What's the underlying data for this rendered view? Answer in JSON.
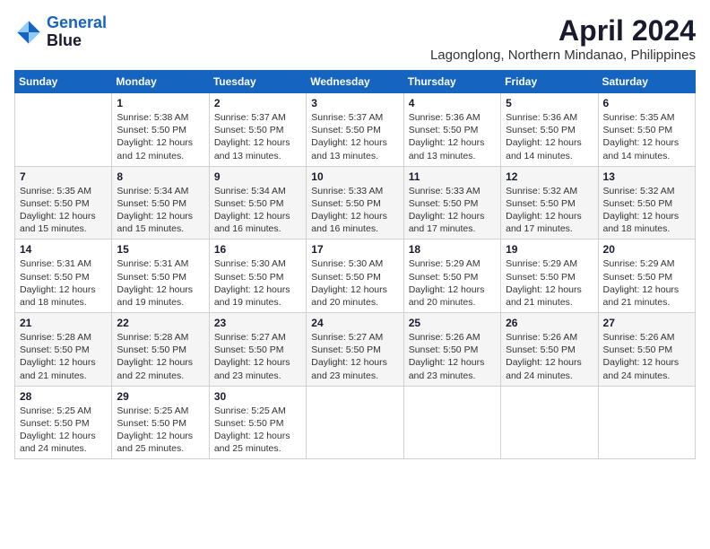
{
  "logo": {
    "line1": "General",
    "line2": "Blue"
  },
  "title": "April 2024",
  "subtitle": "Lagonglong, Northern Mindanao, Philippines",
  "days_header": [
    "Sunday",
    "Monday",
    "Tuesday",
    "Wednesday",
    "Thursday",
    "Friday",
    "Saturday"
  ],
  "weeks": [
    [
      {
        "day": "",
        "sunrise": "",
        "sunset": "",
        "daylight": ""
      },
      {
        "day": "1",
        "sunrise": "Sunrise: 5:38 AM",
        "sunset": "Sunset: 5:50 PM",
        "daylight": "Daylight: 12 hours and 12 minutes."
      },
      {
        "day": "2",
        "sunrise": "Sunrise: 5:37 AM",
        "sunset": "Sunset: 5:50 PM",
        "daylight": "Daylight: 12 hours and 13 minutes."
      },
      {
        "day": "3",
        "sunrise": "Sunrise: 5:37 AM",
        "sunset": "Sunset: 5:50 PM",
        "daylight": "Daylight: 12 hours and 13 minutes."
      },
      {
        "day": "4",
        "sunrise": "Sunrise: 5:36 AM",
        "sunset": "Sunset: 5:50 PM",
        "daylight": "Daylight: 12 hours and 13 minutes."
      },
      {
        "day": "5",
        "sunrise": "Sunrise: 5:36 AM",
        "sunset": "Sunset: 5:50 PM",
        "daylight": "Daylight: 12 hours and 14 minutes."
      },
      {
        "day": "6",
        "sunrise": "Sunrise: 5:35 AM",
        "sunset": "Sunset: 5:50 PM",
        "daylight": "Daylight: 12 hours and 14 minutes."
      }
    ],
    [
      {
        "day": "7",
        "sunrise": "Sunrise: 5:35 AM",
        "sunset": "Sunset: 5:50 PM",
        "daylight": "Daylight: 12 hours and 15 minutes."
      },
      {
        "day": "8",
        "sunrise": "Sunrise: 5:34 AM",
        "sunset": "Sunset: 5:50 PM",
        "daylight": "Daylight: 12 hours and 15 minutes."
      },
      {
        "day": "9",
        "sunrise": "Sunrise: 5:34 AM",
        "sunset": "Sunset: 5:50 PM",
        "daylight": "Daylight: 12 hours and 16 minutes."
      },
      {
        "day": "10",
        "sunrise": "Sunrise: 5:33 AM",
        "sunset": "Sunset: 5:50 PM",
        "daylight": "Daylight: 12 hours and 16 minutes."
      },
      {
        "day": "11",
        "sunrise": "Sunrise: 5:33 AM",
        "sunset": "Sunset: 5:50 PM",
        "daylight": "Daylight: 12 hours and 17 minutes."
      },
      {
        "day": "12",
        "sunrise": "Sunrise: 5:32 AM",
        "sunset": "Sunset: 5:50 PM",
        "daylight": "Daylight: 12 hours and 17 minutes."
      },
      {
        "day": "13",
        "sunrise": "Sunrise: 5:32 AM",
        "sunset": "Sunset: 5:50 PM",
        "daylight": "Daylight: 12 hours and 18 minutes."
      }
    ],
    [
      {
        "day": "14",
        "sunrise": "Sunrise: 5:31 AM",
        "sunset": "Sunset: 5:50 PM",
        "daylight": "Daylight: 12 hours and 18 minutes."
      },
      {
        "day": "15",
        "sunrise": "Sunrise: 5:31 AM",
        "sunset": "Sunset: 5:50 PM",
        "daylight": "Daylight: 12 hours and 19 minutes."
      },
      {
        "day": "16",
        "sunrise": "Sunrise: 5:30 AM",
        "sunset": "Sunset: 5:50 PM",
        "daylight": "Daylight: 12 hours and 19 minutes."
      },
      {
        "day": "17",
        "sunrise": "Sunrise: 5:30 AM",
        "sunset": "Sunset: 5:50 PM",
        "daylight": "Daylight: 12 hours and 20 minutes."
      },
      {
        "day": "18",
        "sunrise": "Sunrise: 5:29 AM",
        "sunset": "Sunset: 5:50 PM",
        "daylight": "Daylight: 12 hours and 20 minutes."
      },
      {
        "day": "19",
        "sunrise": "Sunrise: 5:29 AM",
        "sunset": "Sunset: 5:50 PM",
        "daylight": "Daylight: 12 hours and 21 minutes."
      },
      {
        "day": "20",
        "sunrise": "Sunrise: 5:29 AM",
        "sunset": "Sunset: 5:50 PM",
        "daylight": "Daylight: 12 hours and 21 minutes."
      }
    ],
    [
      {
        "day": "21",
        "sunrise": "Sunrise: 5:28 AM",
        "sunset": "Sunset: 5:50 PM",
        "daylight": "Daylight: 12 hours and 21 minutes."
      },
      {
        "day": "22",
        "sunrise": "Sunrise: 5:28 AM",
        "sunset": "Sunset: 5:50 PM",
        "daylight": "Daylight: 12 hours and 22 minutes."
      },
      {
        "day": "23",
        "sunrise": "Sunrise: 5:27 AM",
        "sunset": "Sunset: 5:50 PM",
        "daylight": "Daylight: 12 hours and 23 minutes."
      },
      {
        "day": "24",
        "sunrise": "Sunrise: 5:27 AM",
        "sunset": "Sunset: 5:50 PM",
        "daylight": "Daylight: 12 hours and 23 minutes."
      },
      {
        "day": "25",
        "sunrise": "Sunrise: 5:26 AM",
        "sunset": "Sunset: 5:50 PM",
        "daylight": "Daylight: 12 hours and 23 minutes."
      },
      {
        "day": "26",
        "sunrise": "Sunrise: 5:26 AM",
        "sunset": "Sunset: 5:50 PM",
        "daylight": "Daylight: 12 hours and 24 minutes."
      },
      {
        "day": "27",
        "sunrise": "Sunrise: 5:26 AM",
        "sunset": "Sunset: 5:50 PM",
        "daylight": "Daylight: 12 hours and 24 minutes."
      }
    ],
    [
      {
        "day": "28",
        "sunrise": "Sunrise: 5:25 AM",
        "sunset": "Sunset: 5:50 PM",
        "daylight": "Daylight: 12 hours and 24 minutes."
      },
      {
        "day": "29",
        "sunrise": "Sunrise: 5:25 AM",
        "sunset": "Sunset: 5:50 PM",
        "daylight": "Daylight: 12 hours and 25 minutes."
      },
      {
        "day": "30",
        "sunrise": "Sunrise: 5:25 AM",
        "sunset": "Sunset: 5:50 PM",
        "daylight": "Daylight: 12 hours and 25 minutes."
      },
      {
        "day": "",
        "sunrise": "",
        "sunset": "",
        "daylight": ""
      },
      {
        "day": "",
        "sunrise": "",
        "sunset": "",
        "daylight": ""
      },
      {
        "day": "",
        "sunrise": "",
        "sunset": "",
        "daylight": ""
      },
      {
        "day": "",
        "sunrise": "",
        "sunset": "",
        "daylight": ""
      }
    ]
  ]
}
